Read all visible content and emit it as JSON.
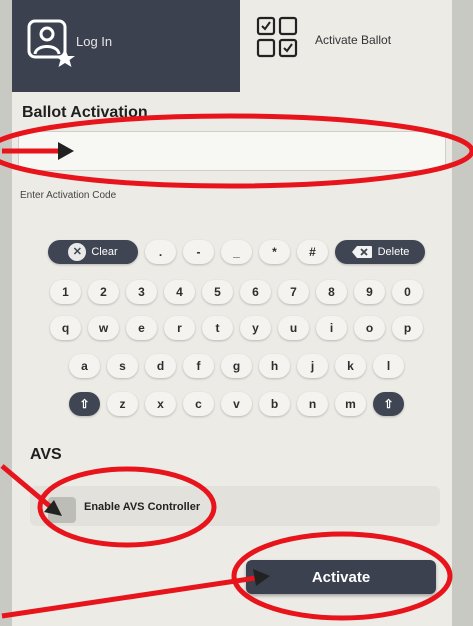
{
  "tabs": {
    "login": {
      "label": "Log In"
    },
    "activate": {
      "label": "Activate Ballot"
    }
  },
  "ballot_activation": {
    "title": "Ballot Activation",
    "input_value": "",
    "help_text": "Enter Activation Code"
  },
  "keyboard": {
    "clear_label": "Clear",
    "delete_label": "Delete",
    "symbol_row": [
      ".",
      "-",
      "_",
      "*",
      "#"
    ],
    "digit_row": [
      "1",
      "2",
      "3",
      "4",
      "5",
      "6",
      "7",
      "8",
      "9",
      "0"
    ],
    "row_q": [
      "q",
      "w",
      "e",
      "r",
      "t",
      "y",
      "u",
      "i",
      "o",
      "p"
    ],
    "row_a": [
      "a",
      "s",
      "d",
      "f",
      "g",
      "h",
      "j",
      "k",
      "l"
    ],
    "row_z": [
      "z",
      "x",
      "c",
      "v",
      "b",
      "n",
      "m"
    ],
    "shift_icon": "shift-arrow-icon"
  },
  "avs": {
    "title": "AVS",
    "toggle_label": "Enable AVS Controller"
  },
  "activate_button": {
    "label": "Activate"
  },
  "colors": {
    "dark": "#3b414e",
    "panel": "#ecebe6",
    "annotation": "#e8141b"
  }
}
